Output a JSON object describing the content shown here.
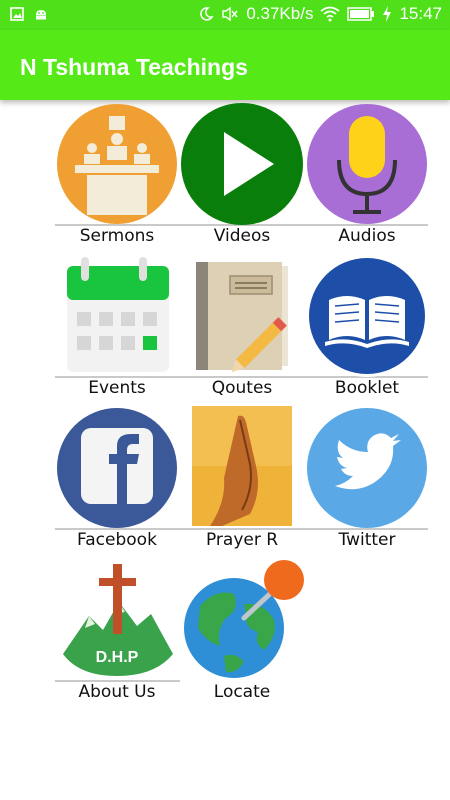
{
  "status_bar": {
    "network_speed": "0.37Kb/s",
    "time": "15:47",
    "icons": [
      "image-icon",
      "android-icon",
      "moon-icon",
      "mute-icon",
      "wifi-icon",
      "battery-icon",
      "charging-icon"
    ]
  },
  "app_bar": {
    "title": "N Tshuma Teachings"
  },
  "colors": {
    "status_bar": "#4fe01a",
    "app_bar": "#55e918",
    "videos_green": "#0a7e0a",
    "sermons_orange": "#f0a032",
    "audios_purple": "#a86ed6",
    "booklet_blue": "#1e4fa8",
    "facebook_navy": "#3b5998",
    "twitter_blue": "#5aa9e6"
  },
  "grid": {
    "items": [
      {
        "label": "Sermons",
        "icon": "pulpit-icon"
      },
      {
        "label": "Videos",
        "icon": "play-icon"
      },
      {
        "label": "Audios",
        "icon": "microphone-icon"
      },
      {
        "label": "Events",
        "icon": "calendar-icon"
      },
      {
        "label": "Qoutes",
        "icon": "notebook-pencil-icon"
      },
      {
        "label": "Booklet",
        "icon": "open-book-icon"
      },
      {
        "label": "Facebook",
        "icon": "facebook-icon"
      },
      {
        "label": "Prayer R",
        "icon": "praying-hands-icon"
      },
      {
        "label": "Twitter",
        "icon": "twitter-bird-icon"
      },
      {
        "label": "About Us",
        "icon": "dhp-logo-icon"
      },
      {
        "label": "Locate",
        "icon": "globe-pin-icon"
      }
    ],
    "about_logo_text": "D.H.P"
  }
}
